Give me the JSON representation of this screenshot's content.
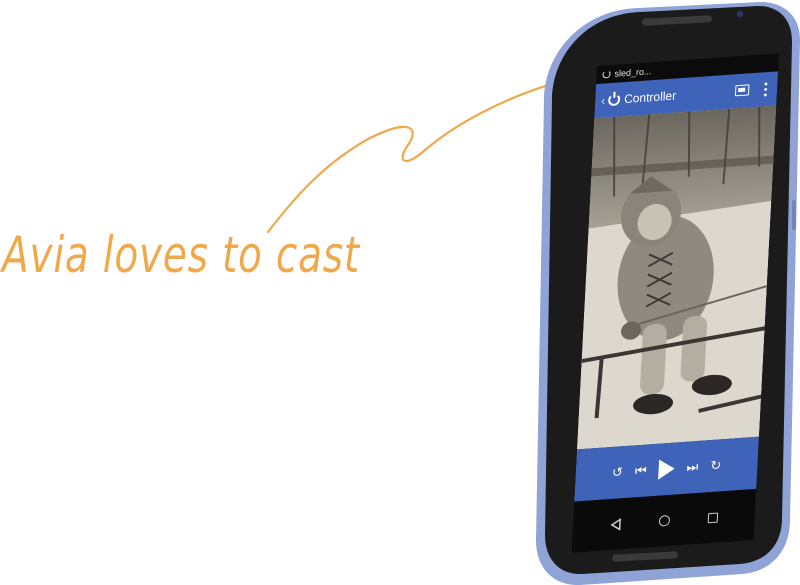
{
  "tagline": "Avia loves to cast",
  "status_bar": {
    "text": "sled_ro..."
  },
  "app_bar": {
    "back_glyph": "‹",
    "title": "Controller",
    "icons": [
      "power-icon",
      "cast-icon",
      "more-vert-icon"
    ]
  },
  "controls": {
    "replay_glyph": "↺",
    "prev_glyph": "⏮",
    "next_glyph": "⏭",
    "forward_glyph": "↻",
    "icons": [
      "replay-icon",
      "skip-previous-icon",
      "play-icon",
      "skip-next-icon",
      "forward-icon"
    ]
  },
  "nav_bar": {
    "icons": [
      "nav-back-icon",
      "nav-home-icon",
      "nav-recents-icon"
    ]
  },
  "colors": {
    "accent_orange": "#f0a94a",
    "app_blue": "#3f63b8",
    "phone_frame_blue": "#8fa3d6",
    "phone_body": "#1b1b1b"
  }
}
